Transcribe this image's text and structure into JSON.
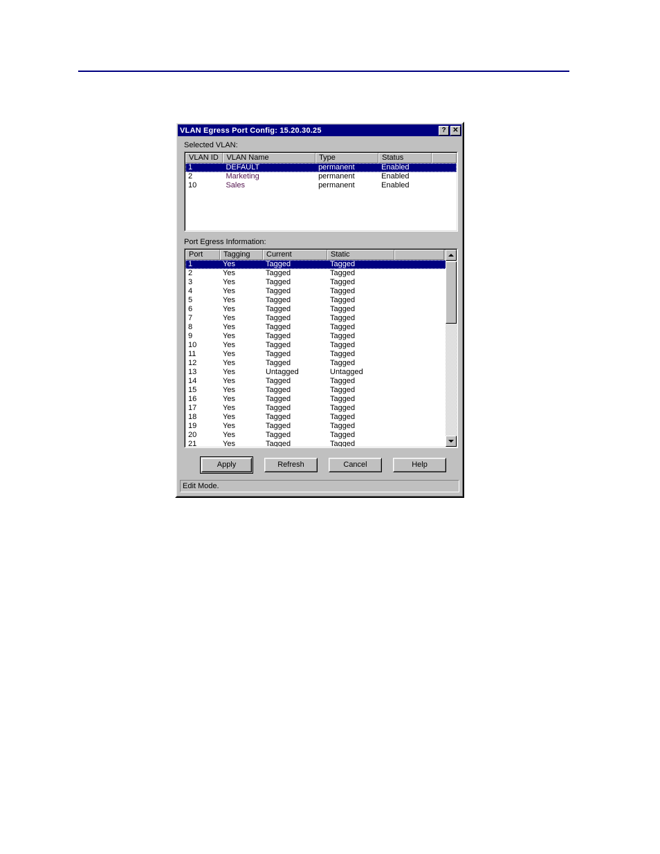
{
  "page": {
    "rule_color": "#000080"
  },
  "dialog": {
    "title": "VLAN Egress Port Config: 15.20.30.25",
    "titlebar_color": "#000080",
    "help_button": "?",
    "close_button": "✕",
    "selected_vlan_label": "Selected VLAN:",
    "port_egress_label": "Port Egress Information:"
  },
  "vlan_table": {
    "columns": [
      "VLAN ID",
      "VLAN Name",
      "Type",
      "Status",
      ""
    ],
    "rows": [
      {
        "id": "1",
        "name": "DEFAULT",
        "type": "permanent",
        "status": "Enabled",
        "selected": true
      },
      {
        "id": "2",
        "name": "Marketing",
        "type": "permanent",
        "status": "Enabled",
        "selected": false
      },
      {
        "id": "10",
        "name": "Sales",
        "type": "permanent",
        "status": "Enabled",
        "selected": false
      }
    ]
  },
  "port_table": {
    "columns": [
      "Port",
      "Tagging",
      "Current",
      "Static",
      ""
    ],
    "rows": [
      {
        "port": "1",
        "tagging": "Yes",
        "current": "Tagged",
        "static": "Tagged",
        "selected": true
      },
      {
        "port": "2",
        "tagging": "Yes",
        "current": "Tagged",
        "static": "Tagged",
        "selected": false
      },
      {
        "port": "3",
        "tagging": "Yes",
        "current": "Tagged",
        "static": "Tagged",
        "selected": false
      },
      {
        "port": "4",
        "tagging": "Yes",
        "current": "Tagged",
        "static": "Tagged",
        "selected": false
      },
      {
        "port": "5",
        "tagging": "Yes",
        "current": "Tagged",
        "static": "Tagged",
        "selected": false
      },
      {
        "port": "6",
        "tagging": "Yes",
        "current": "Tagged",
        "static": "Tagged",
        "selected": false
      },
      {
        "port": "7",
        "tagging": "Yes",
        "current": "Tagged",
        "static": "Tagged",
        "selected": false
      },
      {
        "port": "8",
        "tagging": "Yes",
        "current": "Tagged",
        "static": "Tagged",
        "selected": false
      },
      {
        "port": "9",
        "tagging": "Yes",
        "current": "Tagged",
        "static": "Tagged",
        "selected": false
      },
      {
        "port": "10",
        "tagging": "Yes",
        "current": "Tagged",
        "static": "Tagged",
        "selected": false
      },
      {
        "port": "11",
        "tagging": "Yes",
        "current": "Tagged",
        "static": "Tagged",
        "selected": false
      },
      {
        "port": "12",
        "tagging": "Yes",
        "current": "Tagged",
        "static": "Tagged",
        "selected": false
      },
      {
        "port": "13",
        "tagging": "Yes",
        "current": "Untagged",
        "static": "Untagged",
        "selected": false
      },
      {
        "port": "14",
        "tagging": "Yes",
        "current": "Tagged",
        "static": "Tagged",
        "selected": false
      },
      {
        "port": "15",
        "tagging": "Yes",
        "current": "Tagged",
        "static": "Tagged",
        "selected": false
      },
      {
        "port": "16",
        "tagging": "Yes",
        "current": "Tagged",
        "static": "Tagged",
        "selected": false
      },
      {
        "port": "17",
        "tagging": "Yes",
        "current": "Tagged",
        "static": "Tagged",
        "selected": false
      },
      {
        "port": "18",
        "tagging": "Yes",
        "current": "Tagged",
        "static": "Tagged",
        "selected": false
      },
      {
        "port": "19",
        "tagging": "Yes",
        "current": "Tagged",
        "static": "Tagged",
        "selected": false
      },
      {
        "port": "20",
        "tagging": "Yes",
        "current": "Tagged",
        "static": "Tagged",
        "selected": false
      },
      {
        "port": "21",
        "tagging": "Yes",
        "current": "Tagged",
        "static": "Tagged",
        "selected": false
      }
    ],
    "scrollbar": {
      "up_arrow": "up-arrow",
      "down_arrow": "down-arrow",
      "thumb_position": "top"
    }
  },
  "buttons": {
    "apply": "Apply",
    "refresh": "Refresh",
    "cancel": "Cancel",
    "help": "Help"
  },
  "statusbar": {
    "text": "Edit Mode."
  }
}
